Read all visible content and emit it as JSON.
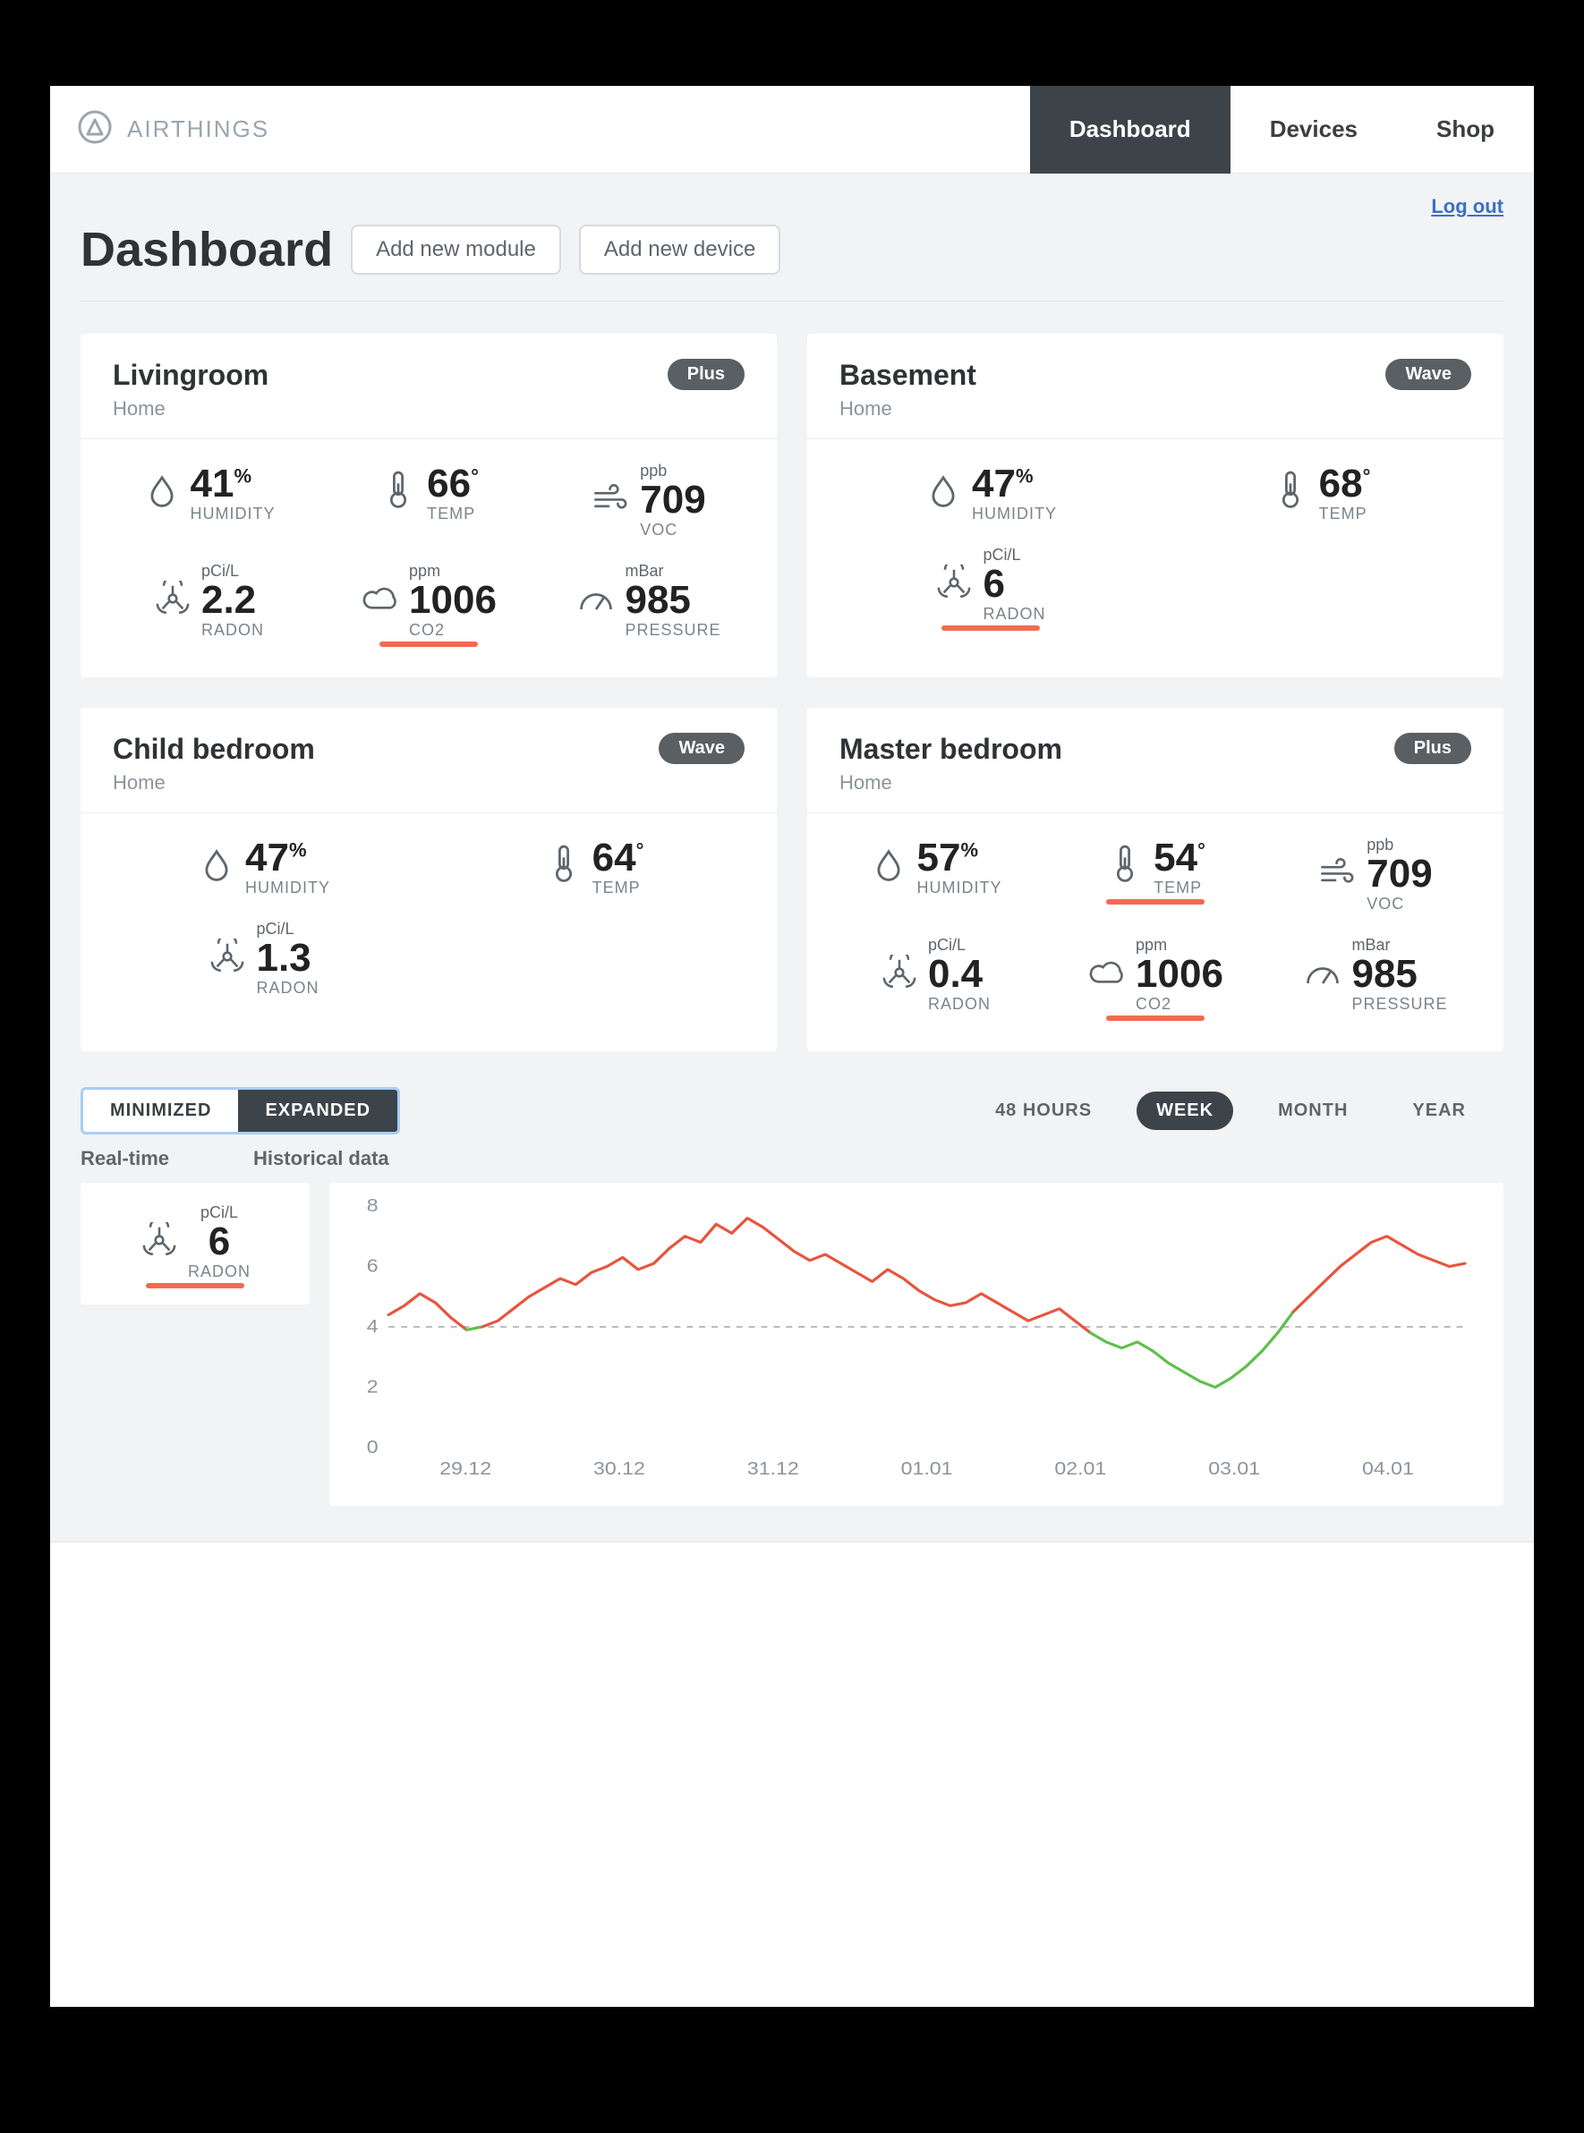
{
  "brand": {
    "name": "AIRTHINGS"
  },
  "nav": {
    "items": [
      {
        "label": "Dashboard",
        "active": true
      },
      {
        "label": "Devices",
        "active": false
      },
      {
        "label": "Shop",
        "active": false
      }
    ]
  },
  "header": {
    "logout": "Log out",
    "title": "Dashboard",
    "add_module": "Add new module",
    "add_device": "Add new device"
  },
  "cards": [
    {
      "title": "Livingroom",
      "location": "Home",
      "badge": "Plus",
      "cols": 3,
      "metrics": [
        {
          "icon": "humidity",
          "unit": "",
          "value": "41",
          "suffix": "%",
          "label": "HUMIDITY",
          "alert": false
        },
        {
          "icon": "temp",
          "unit": "",
          "value": "66",
          "suffix": "°",
          "label": "TEMP",
          "alert": false
        },
        {
          "icon": "voc",
          "unit": "ppb",
          "value": "709",
          "suffix": "",
          "label": "VOC",
          "alert": false
        },
        {
          "icon": "radon",
          "unit": "pCi/L",
          "value": "2.2",
          "suffix": "",
          "label": "RADON",
          "alert": false
        },
        {
          "icon": "co2",
          "unit": "ppm",
          "value": "1006",
          "suffix": "",
          "label": "CO2",
          "alert": true
        },
        {
          "icon": "pressure",
          "unit": "mBar",
          "value": "985",
          "suffix": "",
          "label": "PRESSURE",
          "alert": false
        }
      ]
    },
    {
      "title": "Basement",
      "location": "Home",
      "badge": "Wave",
      "cols": 2,
      "metrics": [
        {
          "icon": "humidity",
          "unit": "",
          "value": "47",
          "suffix": "%",
          "label": "HUMIDITY",
          "alert": false
        },
        {
          "icon": "temp",
          "unit": "",
          "value": "68",
          "suffix": "°",
          "label": "TEMP",
          "alert": false
        },
        {
          "icon": "radon",
          "unit": "pCi/L",
          "value": "6",
          "suffix": "",
          "label": "RADON",
          "alert": true
        }
      ]
    },
    {
      "title": "Child bedroom",
      "location": "Home",
      "badge": "Wave",
      "cols": 2,
      "metrics": [
        {
          "icon": "humidity",
          "unit": "",
          "value": "47",
          "suffix": "%",
          "label": "HUMIDITY",
          "alert": false
        },
        {
          "icon": "temp",
          "unit": "",
          "value": "64",
          "suffix": "°",
          "label": "TEMP",
          "alert": false
        },
        {
          "icon": "radon",
          "unit": "pCi/L",
          "value": "1.3",
          "suffix": "",
          "label": "RADON",
          "alert": false
        }
      ]
    },
    {
      "title": "Master bedroom",
      "location": "Home",
      "badge": "Plus",
      "cols": 3,
      "metrics": [
        {
          "icon": "humidity",
          "unit": "",
          "value": "57",
          "suffix": "%",
          "label": "HUMIDITY",
          "alert": false
        },
        {
          "icon": "temp",
          "unit": "",
          "value": "54",
          "suffix": "°",
          "label": "TEMP",
          "alert": true
        },
        {
          "icon": "voc",
          "unit": "ppb",
          "value": "709",
          "suffix": "",
          "label": "VOC",
          "alert": false
        },
        {
          "icon": "radon",
          "unit": "pCi/L",
          "value": "0.4",
          "suffix": "",
          "label": "RADON",
          "alert": false
        },
        {
          "icon": "co2",
          "unit": "ppm",
          "value": "1006",
          "suffix": "",
          "label": "CO2",
          "alert": true
        },
        {
          "icon": "pressure",
          "unit": "mBar",
          "value": "985",
          "suffix": "",
          "label": "PRESSURE",
          "alert": false
        }
      ]
    }
  ],
  "view_toggle": {
    "options": [
      {
        "label": "MINIMIZED",
        "active": false
      },
      {
        "label": "EXPANDED",
        "active": true
      }
    ]
  },
  "range_tabs": [
    {
      "label": "48 HOURS",
      "active": false
    },
    {
      "label": "WEEK",
      "active": true
    },
    {
      "label": "MONTH",
      "active": false
    },
    {
      "label": "YEAR",
      "active": false
    }
  ],
  "sections": {
    "realtime": "Real-time",
    "historical": "Historical data"
  },
  "realtime": {
    "icon": "radon",
    "unit": "pCi/L",
    "value": "6",
    "label": "RADON",
    "alert": true
  },
  "chart_data": {
    "type": "line",
    "title": "",
    "xlabel": "",
    "ylabel": "",
    "ylim": [
      0,
      8
    ],
    "yticks": [
      0,
      2,
      4,
      6,
      8
    ],
    "threshold": 4,
    "categories": [
      "29.12",
      "30.12",
      "31.12",
      "01.01",
      "02.01",
      "03.01",
      "04.01"
    ],
    "x": [
      0,
      1,
      2,
      3,
      4,
      5,
      6,
      7,
      8,
      9,
      10,
      11,
      12,
      13,
      14,
      15,
      16,
      17,
      18,
      19,
      20,
      21,
      22,
      23,
      24,
      25,
      26,
      27,
      28,
      29,
      30,
      31,
      32,
      33,
      34,
      35,
      36,
      37,
      38,
      39,
      40,
      41,
      42,
      43,
      44,
      45,
      46,
      47,
      48,
      49,
      50,
      51,
      52,
      53,
      54,
      55,
      56,
      57,
      58,
      59,
      60,
      61,
      62,
      63,
      64,
      65,
      66,
      67,
      68,
      69
    ],
    "series": [
      {
        "name": "Radon",
        "values": [
          4.4,
          4.7,
          5.1,
          4.8,
          4.3,
          3.9,
          4.0,
          4.2,
          4.6,
          5.0,
          5.3,
          5.6,
          5.4,
          5.8,
          6.0,
          6.3,
          5.9,
          6.1,
          6.6,
          7.0,
          6.8,
          7.4,
          7.1,
          7.6,
          7.3,
          6.9,
          6.5,
          6.2,
          6.4,
          6.1,
          5.8,
          5.5,
          5.9,
          5.6,
          5.2,
          4.9,
          4.7,
          4.8,
          5.1,
          4.8,
          4.5,
          4.2,
          4.4,
          4.6,
          4.2,
          3.8,
          3.5,
          3.3,
          3.5,
          3.2,
          2.8,
          2.5,
          2.2,
          2.0,
          2.3,
          2.7,
          3.2,
          3.8,
          4.5,
          5.0,
          5.5,
          6.0,
          6.4,
          6.8,
          7.0,
          6.7,
          6.4,
          6.2,
          6.0,
          6.1
        ]
      }
    ]
  }
}
